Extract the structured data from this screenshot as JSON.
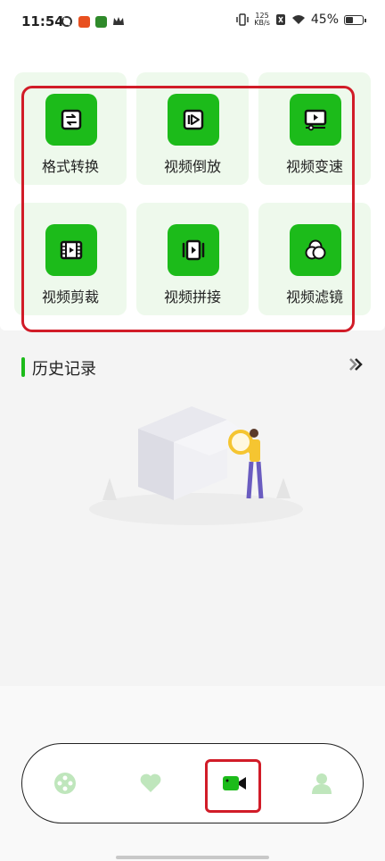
{
  "status_bar": {
    "time": "11:54",
    "net_speed_value": "125",
    "net_speed_unit": "KB/s",
    "battery_percent": "45%"
  },
  "tools": [
    {
      "label": "格式转换",
      "icon": "format-convert-icon"
    },
    {
      "label": "视频倒放",
      "icon": "reverse-play-icon"
    },
    {
      "label": "视频变速",
      "icon": "speed-change-icon"
    },
    {
      "label": "视频剪裁",
      "icon": "film-crop-icon"
    },
    {
      "label": "视频拼接",
      "icon": "video-merge-icon"
    },
    {
      "label": "视频滤镜",
      "icon": "filter-circles-icon"
    }
  ],
  "history": {
    "title": "历史记录",
    "more_icon": "double-chevron-right-icon"
  },
  "tab_bar": {
    "items": [
      {
        "icon": "film-reel-icon",
        "active": false
      },
      {
        "icon": "heart-icon",
        "active": false
      },
      {
        "icon": "video-camera-icon",
        "active": true
      },
      {
        "icon": "user-icon",
        "active": false
      }
    ]
  },
  "colors": {
    "accent_green": "#1cbb1a",
    "card_bg": "#eef9ec",
    "highlight_red": "#d11c28"
  }
}
